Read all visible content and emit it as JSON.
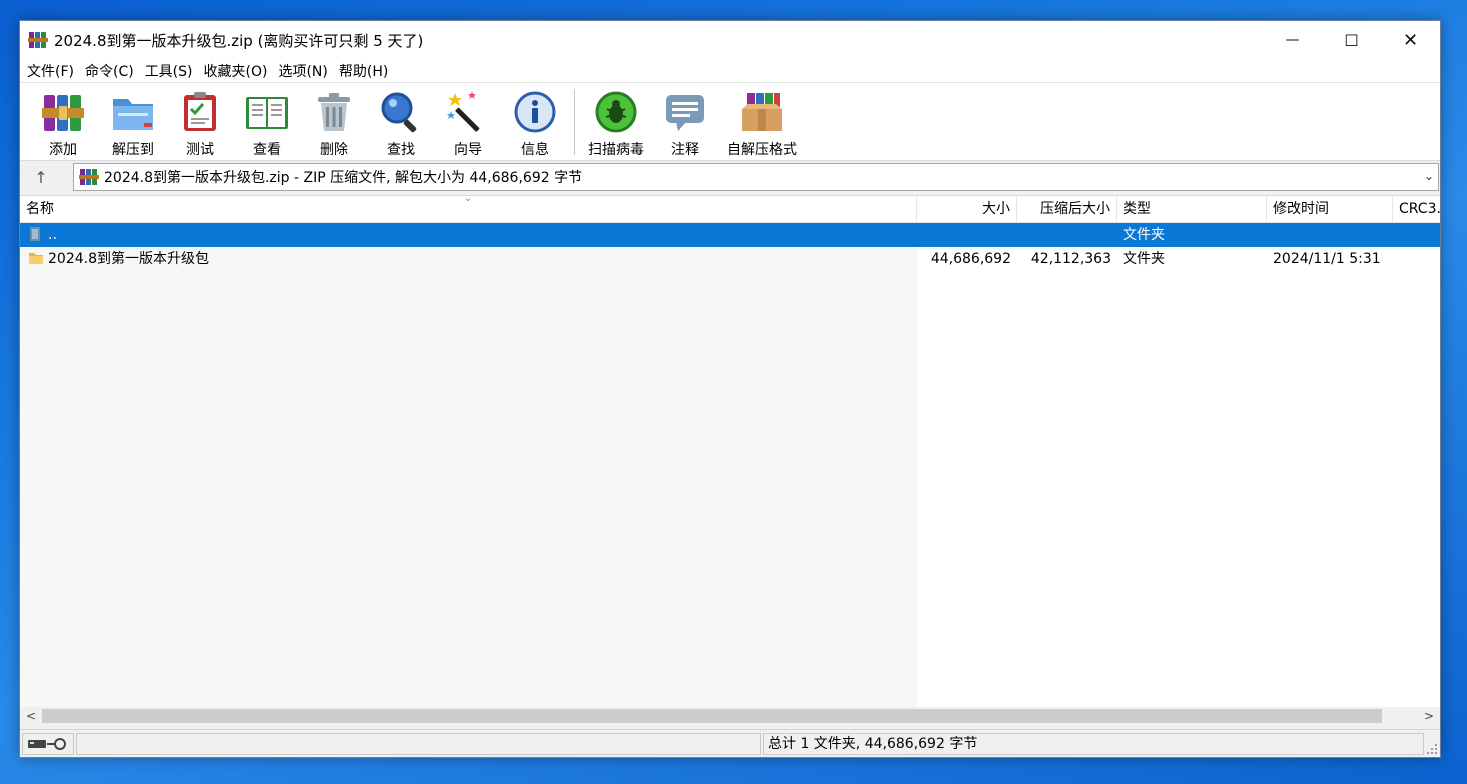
{
  "window": {
    "title": "2024.8到第一版本升级包.zip (离购买许可只剩 5 天了)",
    "controls": {
      "minimize": "—",
      "maximize": "☐",
      "close": "✕"
    }
  },
  "menu": [
    {
      "label": "文件(F)"
    },
    {
      "label": "命令(C)"
    },
    {
      "label": "工具(S)"
    },
    {
      "label": "收藏夹(O)"
    },
    {
      "label": "选项(N)"
    },
    {
      "label": "帮助(H)"
    }
  ],
  "toolbar": [
    {
      "label": "添加",
      "icon": "add-archive-icon"
    },
    {
      "label": "解压到",
      "icon": "extract-folder-icon"
    },
    {
      "label": "测试",
      "icon": "test-clipboard-icon"
    },
    {
      "label": "查看",
      "icon": "view-book-icon"
    },
    {
      "label": "删除",
      "icon": "delete-trash-icon"
    },
    {
      "label": "查找",
      "icon": "find-magnifier-icon"
    },
    {
      "label": "向导",
      "icon": "wizard-wand-icon"
    },
    {
      "label": "信息",
      "icon": "info-icon"
    },
    {
      "label": "扫描病毒",
      "icon": "virus-scan-icon"
    },
    {
      "label": "注释",
      "icon": "comment-icon"
    },
    {
      "label": "自解压格式",
      "icon": "sfx-box-icon"
    }
  ],
  "address": {
    "up_icon": "↑",
    "text": "2024.8到第一版本升级包.zip - ZIP 压缩文件, 解包大小为 44,686,692 字节",
    "dropdown": "⌄"
  },
  "columns": {
    "name": "名称",
    "size": "大小",
    "packed": "压缩后大小",
    "type": "类型",
    "modified": "修改时间",
    "crc": "CRC3..."
  },
  "rows": [
    {
      "name": "..",
      "size": "",
      "packed": "",
      "type": "文件夹",
      "modified": "",
      "selected": true
    },
    {
      "name": "2024.8到第一版本升级包",
      "size": "44,686,692",
      "packed": "42,112,363",
      "type": "文件夹",
      "modified": "2024/11/1 5:31",
      "selected": false
    }
  ],
  "scrollbar": {
    "left": "<",
    "right": ">"
  },
  "status": {
    "summary": "总计 1 文件夹, 44,686,692 字节"
  },
  "colors": {
    "selection": "#0a78d6",
    "desktop": "#1a7be0"
  }
}
